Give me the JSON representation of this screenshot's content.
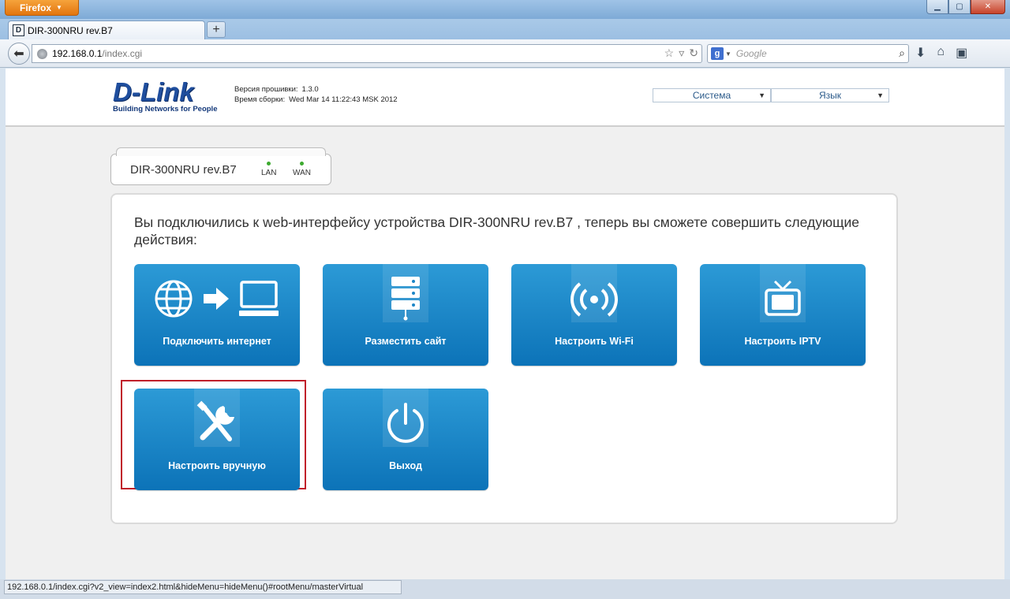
{
  "browser": {
    "menu_label": "Firefox",
    "tab_title": "DIR-300NRU rev.B7",
    "new_tab": "+",
    "url_host": "192.168.0.1",
    "url_path": "/index.cgi",
    "search_placeholder": "Google",
    "status_url": "192.168.0.1/index.cgi?v2_view=index2.html&hideMenu=hideMenu()#rootMenu/masterVirtual"
  },
  "header": {
    "logo_text": "D-Link",
    "logo_tagline": "Building Networks for People",
    "firmware_label": "Версия прошивки:",
    "firmware_value": "1.3.0",
    "build_label": "Время сборки:",
    "build_value": "Wed Mar 14 11:22:43 MSK 2012",
    "system_select": "Система",
    "language_select": "Язык"
  },
  "device": {
    "name": "DIR-300NRU rev.B7",
    "lan_label": "LAN",
    "wan_label": "WAN"
  },
  "main": {
    "intro_text": "Вы подключились к web-интерфейсу устройства DIR-300NRU rev.B7 , теперь вы сможете совершить следующие действия:",
    "tiles": [
      {
        "label": "Подключить интернет",
        "icon": "globe-to-computer-icon"
      },
      {
        "label": "Разместить сайт",
        "icon": "server-icon"
      },
      {
        "label": "Настроить Wi-Fi",
        "icon": "wifi-icon"
      },
      {
        "label": "Настроить IPTV",
        "icon": "tv-icon"
      },
      {
        "label": "Настроить вручную",
        "icon": "tools-icon",
        "selected": true
      },
      {
        "label": "Выход",
        "icon": "power-icon"
      }
    ]
  },
  "colors": {
    "tile_top": "#2c9ad6",
    "tile_bottom": "#0c73b8",
    "selection_border": "#c0202a",
    "led": "#3daa30"
  }
}
